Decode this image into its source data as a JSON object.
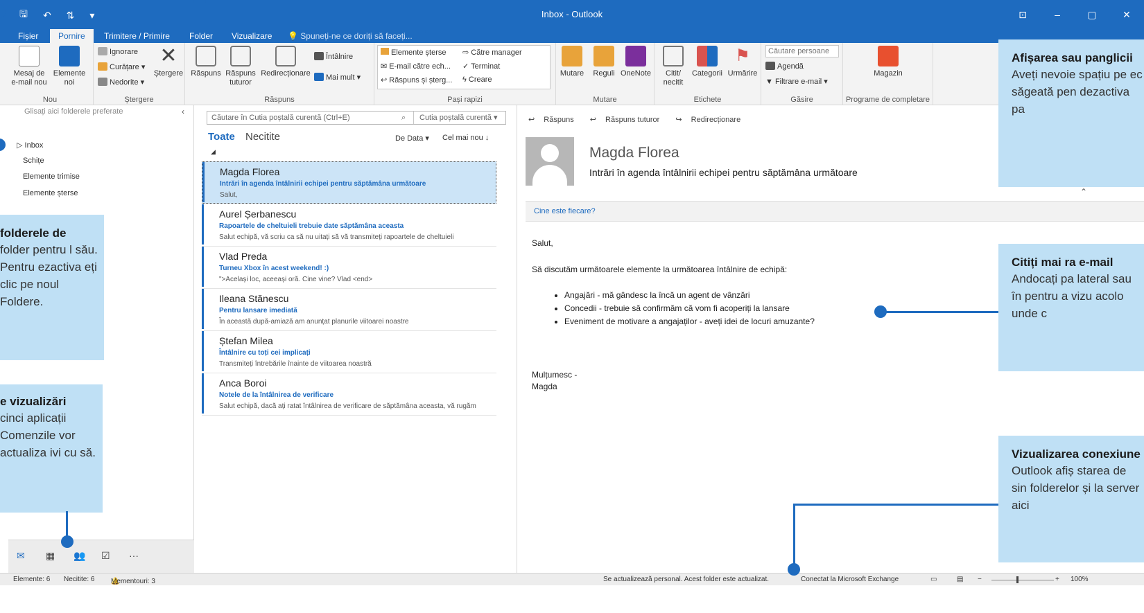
{
  "window": {
    "title": "Inbox - Outlook",
    "qat_icons": [
      "save-icon",
      "undo-icon",
      "send-receive-icon",
      "customize-icon"
    ]
  },
  "tabs": [
    {
      "label": "Fișier",
      "active": false
    },
    {
      "label": "Pornire",
      "active": true
    },
    {
      "label": "Trimitere / Primire",
      "active": false
    },
    {
      "label": "Folder",
      "active": false
    },
    {
      "label": "Vizualizare",
      "active": false
    }
  ],
  "tell_me": "Spuneți-ne ce doriți să faceți...",
  "ribbon": {
    "nou": {
      "label": "Nou",
      "new_email": "Mesaj de e-mail nou",
      "new_items": "Elemente noi"
    },
    "stergere": {
      "label": "Ștergere",
      "ignore": "Ignorare",
      "cleanup": "Curățare",
      "junk": "Nedorite",
      "delete": "Ștergere"
    },
    "raspuns": {
      "label": "Răspuns",
      "reply": "Răspuns",
      "reply_all": "Răspuns tuturor",
      "forward": "Redirecționare",
      "meeting": "Întâlnire",
      "more": "Mai mult"
    },
    "pasi_rapizi": {
      "label": "Pași rapizi",
      "items": [
        "Elemente șterse",
        "Către manager",
        "E-mail către ech...",
        "Terminat",
        "Răspuns și șterg...",
        "Creare"
      ]
    },
    "mutare": {
      "label": "Mutare",
      "move": "Mutare",
      "rules": "Reguli",
      "onenote": "OneNote"
    },
    "etichete": {
      "label": "Etichete",
      "read_unread": "Citit/ necitit",
      "categories": "Categorii",
      "followup": "Urmărire"
    },
    "gasire": {
      "label": "Găsire",
      "search_people": "Căutare persoane",
      "address_book": "Agendă",
      "filter": "Filtrare e-mail"
    },
    "addins": {
      "label": "Programe de completare",
      "store": "Magazin"
    }
  },
  "folder_pane": {
    "fav_hint": "Glisați aici folderele preferate",
    "folders": [
      "Inbox",
      "Schițe",
      "Elemente trimise",
      "Elemente șterse"
    ]
  },
  "message_list": {
    "search_placeholder": "Căutare în Cutia poștală curentă (Ctrl+E)",
    "scope": "Cutia poștală curentă",
    "filter_all": "Toate",
    "filter_unread": "Necitite",
    "sort_by": "De Data",
    "sort_order": "Cel mai nou",
    "messages": [
      {
        "from": "Magda Florea",
        "subject": "Intrări în agenda întâlnirii echipei pentru săptămâna următoare",
        "preview": "Salut,"
      },
      {
        "from": "Aurel Șerbanescu",
        "subject": "Rapoartele de cheltuieli trebuie date săptămâna aceasta",
        "preview": "Salut echipă, vă scriu ca să nu uitați să vă transmiteți rapoartele de cheltuieli"
      },
      {
        "from": "Vlad Preda",
        "subject": "Turneu Xbox în acest weekend! :)",
        "preview": "\">Același loc, aceeași oră. Cine vine? Vlad <end>"
      },
      {
        "from": "Ileana Stănescu",
        "subject": "Pentru lansare imediată",
        "preview": "În această după-amiază am anunțat planurile viitoarei noastre"
      },
      {
        "from": "Ștefan Milea",
        "subject": "Întâlnire cu toți cei implicați",
        "preview": "Transmiteți întrebările înainte de viitoarea noastră"
      },
      {
        "from": "Anca Boroi",
        "subject": "Notele de la întâlnirea de verificare",
        "preview": "Salut echipă, dacă ați ratat întâlnirea de verificare de săptămâna aceasta, vă rugăm"
      }
    ]
  },
  "reading_pane": {
    "actions": [
      "Răspuns",
      "Răspuns tuturor",
      "Redirecționare"
    ],
    "sender": "Magda Florea",
    "subject": "Intrări în agenda întâlnirii echipei pentru săptămâna următoare",
    "who_is": "Cine este fiecare?",
    "greeting": "Salut,",
    "intro": "Să discutăm următoarele elemente la următoarea întâlnire de echipă:",
    "bullets": [
      "Angajări - mă gândesc la încă un agent de vânzări",
      "Concedii - trebuie să confirmăm că vom fi acoperiți la lansare",
      "Eveniment de motivare a angajaților - aveți idei de locuri amuzante?"
    ],
    "signoff": "Mulțumesc -",
    "signature": "Magda"
  },
  "status_bar": {
    "items": "Elemente: 6",
    "unread": "Necitite: 6",
    "reminders": "Mementouri: 3",
    "updating": "Se actualizează personal.  Acest folder este actualizat.",
    "connection": "Conectat la Microsoft Exchange",
    "zoom": "100%"
  },
  "callouts": {
    "ribbon": {
      "title": "Afișarea sau panglicii",
      "body": "Aveți nevoie spațiu pe ec săgeată pen dezactiva pa"
    },
    "folders": {
      "title": "folderele de",
      "body": "folder pentru l său. Pentru ezactiva eți clic pe noul Foldere."
    },
    "views": {
      "title": "e vizualizări",
      "body": "cinci aplicații Comenzile vor actualiza ivi cu să."
    },
    "reading": {
      "title": "Citiți mai ra e-mail",
      "body": "Andocați pa lateral sau în pentru a vizu acolo unde c"
    },
    "connection": {
      "title": "Vizualizarea conexiune",
      "body": "Outlook afiș starea de sin folderelor și la server aici"
    }
  },
  "colors": {
    "accent": "#1e6bbf",
    "callout_bg": "#bfe0f5",
    "selected_row": "#cce4f7"
  }
}
